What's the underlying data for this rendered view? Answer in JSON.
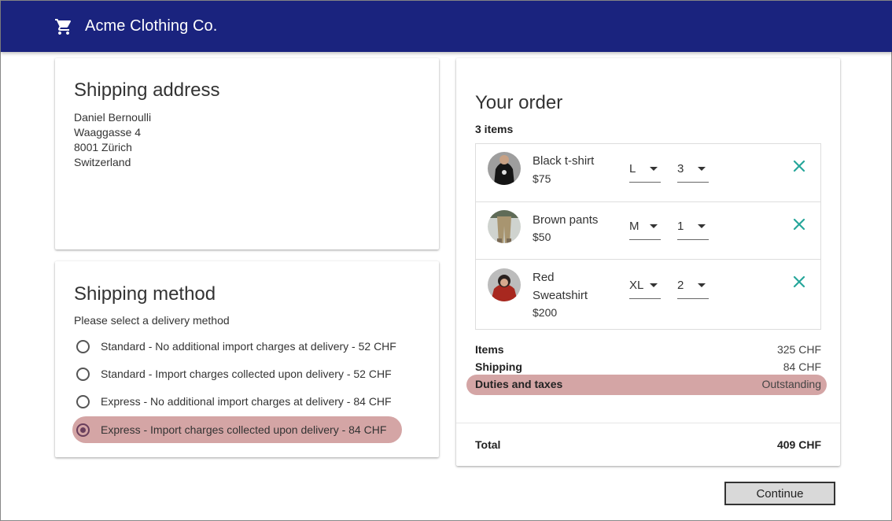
{
  "app": {
    "title": "Acme Clothing Co.",
    "brand_color": "#1a237e",
    "icon": "shopping-cart-icon"
  },
  "shipping_address": {
    "heading": "Shipping address",
    "lines": [
      "Daniel Bernoulli",
      "Waaggasse 4",
      "8001 Zürich",
      "Switzerland"
    ]
  },
  "shipping_method": {
    "heading": "Shipping method",
    "subtitle": "Please select a delivery method",
    "options": [
      {
        "label": "Standard - No additional import charges at delivery - 52 CHF",
        "selected": false
      },
      {
        "label": "Standard - Import charges collected upon delivery - 52 CHF",
        "selected": false
      },
      {
        "label": "Express - No additional import charges at delivery - 84 CHF",
        "selected": false
      },
      {
        "label": "Express - Import charges collected upon delivery - 84 CHF",
        "selected": true
      }
    ],
    "highlight_color": "#d4a5a5"
  },
  "order": {
    "heading": "Your order",
    "items_count": "3 items",
    "items": [
      {
        "name": "Black t-shirt",
        "price": "$75",
        "size": "L",
        "qty": "3"
      },
      {
        "name": "Brown pants",
        "price": "$50",
        "size": "M",
        "qty": "1"
      },
      {
        "name": "Red Sweatshirt",
        "price": "$200",
        "size": "XL",
        "qty": "2"
      }
    ],
    "remove_icon": "close-icon",
    "remove_color": "#26a69a",
    "summary": {
      "items_label": "Items",
      "items_value": "325 CHF",
      "shipping_label": "Shipping",
      "shipping_value": "84 CHF",
      "duties_label": "Duties and taxes",
      "duties_value": "Outstanding",
      "total_label": "Total",
      "total_value": "409 CHF"
    }
  },
  "actions": {
    "continue_label": "Continue"
  }
}
